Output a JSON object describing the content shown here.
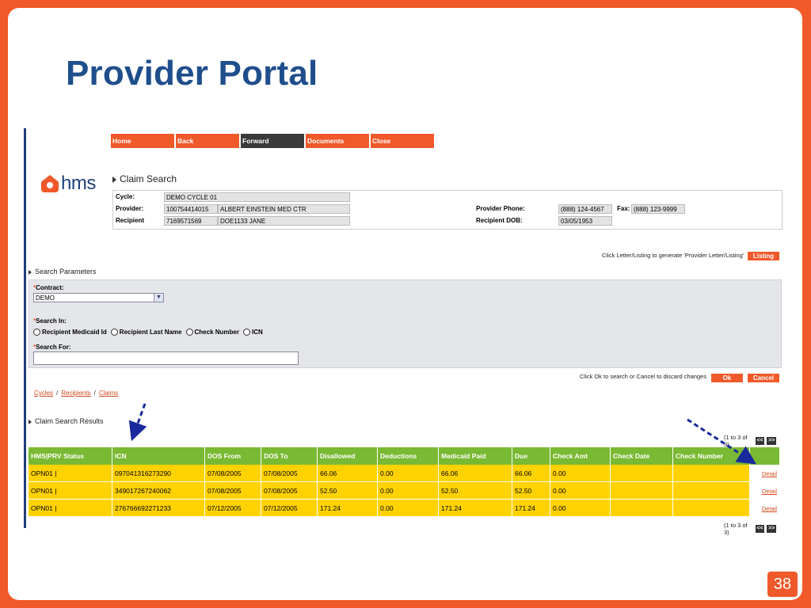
{
  "slide": {
    "title": "Provider Portal",
    "page_number": "38"
  },
  "logo": {
    "text": "hms"
  },
  "nav": [
    {
      "label": "Home",
      "active": false
    },
    {
      "label": "Back",
      "active": false
    },
    {
      "label": "Forward",
      "active": true
    },
    {
      "label": "Documents",
      "active": false
    },
    {
      "label": "Close",
      "active": false
    }
  ],
  "claim_search": {
    "heading": "Claim Search",
    "cycle_label": "Cycle:",
    "cycle_value": "DEMO CYCLE 01",
    "provider_label": "Provider:",
    "provider_id": "100754414015",
    "provider_name": "ALBERT EINSTEIN MED CTR",
    "recipient_label": "Recipient",
    "recipient_id": "7169571569",
    "recipient_name": "DOE1133 JANE",
    "provider_phone_label": "Provider Phone:",
    "provider_phone": "(888) 124-4567",
    "fax_label": "Fax:",
    "fax": "(888) 123-9999",
    "recipient_dob_label": "Recipient DOB:",
    "recipient_dob": "03/05/1953"
  },
  "listing": {
    "note": "Click Letter/Listing to generate 'Provider Letter/Listing'",
    "button": "Listing"
  },
  "search_params": {
    "heading": "Search Parameters",
    "contract_label": "Contract:",
    "contract_value": "DEMO",
    "search_in_label": "Search In:",
    "options": [
      "Recipient Medicaid Id",
      "Recipient Last Name",
      "Check Number",
      "ICN"
    ],
    "search_for_label": "Search For:",
    "search_for_value": ""
  },
  "actions": {
    "note": "Click Ok to search or Cancel to discard changes",
    "ok": "Ok",
    "cancel": "Cancel"
  },
  "breadcrumb": [
    "Cycles",
    "Recipients",
    "Claims"
  ],
  "breadcrumb_sep": "/",
  "results": {
    "heading": "Claim Search Results",
    "pager_text": "(1 to 3 of 3)",
    "prev": "<<",
    "next": ">>",
    "columns": [
      "HMS|PRV Status",
      "ICN",
      "DOS From",
      "DOS To",
      "Disallowed",
      "Deductions",
      "Medicaid Paid",
      "Due",
      "Check Amt",
      "Check Date",
      "Check Number"
    ],
    "rows": [
      [
        "OPN01 |",
        "097041316273290",
        "07/08/2005",
        "07/08/2005",
        "66.06",
        "0.00",
        "66.06",
        "66.06",
        "0.00",
        "",
        ""
      ],
      [
        "OPN01 |",
        "349017267240062",
        "07/08/2005",
        "07/08/2005",
        "52.50",
        "0.00",
        "52.50",
        "52.50",
        "0.00",
        "",
        ""
      ],
      [
        "OPN01 |",
        "276766692271233",
        "07/12/2005",
        "07/12/2005",
        "171.24",
        "0.00",
        "171.24",
        "171.24",
        "0.00",
        "",
        ""
      ]
    ],
    "detail_label": "Detail"
  },
  "colors": {
    "orange": "#f0592a",
    "navy": "#1f4e8c",
    "header_green": "#7ab933",
    "row_yellow": "#ffd200",
    "arrow_blue": "#1a2a9c"
  }
}
